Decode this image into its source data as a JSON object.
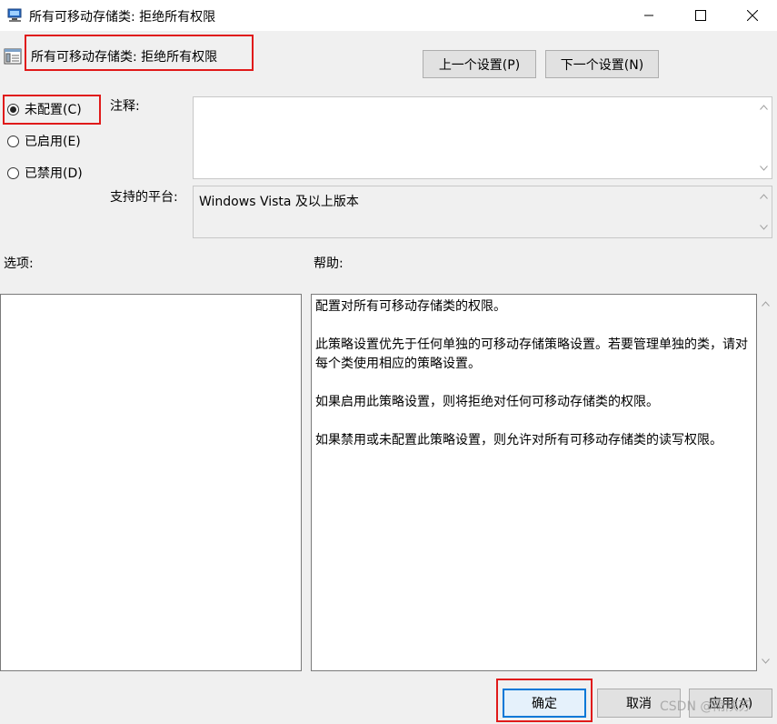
{
  "window": {
    "title": "所有可移动存储类: 拒绝所有权限",
    "controls": {
      "minimize_icon": "minimize-icon",
      "maximize_icon": "maximize-icon",
      "close_icon": "close-icon"
    }
  },
  "header": {
    "policy_title": "所有可移动存储类: 拒绝所有权限",
    "prev_button": "上一个设置(P)",
    "next_button": "下一个设置(N)"
  },
  "state": {
    "options": [
      {
        "label": "未配置(C)",
        "checked": true
      },
      {
        "label": "已启用(E)",
        "checked": false
      },
      {
        "label": "已禁用(D)",
        "checked": false
      }
    ]
  },
  "comment": {
    "label": "注释:",
    "value": ""
  },
  "platform": {
    "label": "支持的平台:",
    "value": "Windows Vista 及以上版本"
  },
  "options_section": {
    "label": "选项:"
  },
  "help_section": {
    "label": "帮助:",
    "paragraphs": [
      "配置对所有可移动存储类的权限。",
      "此策略设置优先于任何单独的可移动存储策略设置。若要管理单独的类，请对每个类使用相应的策略设置。",
      "如果启用此策略设置，则将拒绝对任何可移动存储类的权限。",
      "如果禁用或未配置此策略设置，则允许对所有可移动存储类的读写权限。"
    ]
  },
  "footer": {
    "ok": "确定",
    "cancel": "取消",
    "apply": "应用(A)"
  },
  "watermark": "CSDN @雨陕苏",
  "colors": {
    "highlight_box": "#e01a1a",
    "default_button_border": "#0078d7",
    "background": "#f0f0f0"
  }
}
